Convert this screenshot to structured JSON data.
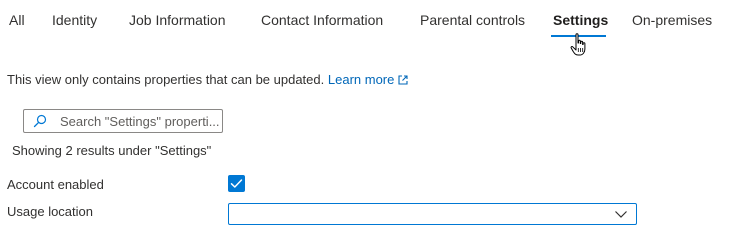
{
  "tabs": [
    {
      "label": "All"
    },
    {
      "label": "Identity"
    },
    {
      "label": "Job Information"
    },
    {
      "label": "Contact Information"
    },
    {
      "label": "Parental controls"
    },
    {
      "label": "Settings",
      "active": true
    },
    {
      "label": "On-premises"
    }
  ],
  "info": {
    "text": "This view only contains properties that can be updated.",
    "link": "Learn more"
  },
  "search": {
    "placeholder": "Search \"Settings\" properti...",
    "value": ""
  },
  "results": {
    "text": "Showing 2 results under \"Settings\""
  },
  "fields": {
    "account_enabled": {
      "label": "Account enabled",
      "checked": true
    },
    "usage_location": {
      "label": "Usage location",
      "value": ""
    }
  },
  "colors": {
    "accent": "#0078d4",
    "link": "#0067b8",
    "text": "#323130"
  },
  "icons": {
    "search": "search-icon",
    "external": "external-link-icon",
    "checkmark": "checkmark-icon",
    "chevron": "chevron-down-icon",
    "cursor": "hand-cursor-icon"
  }
}
